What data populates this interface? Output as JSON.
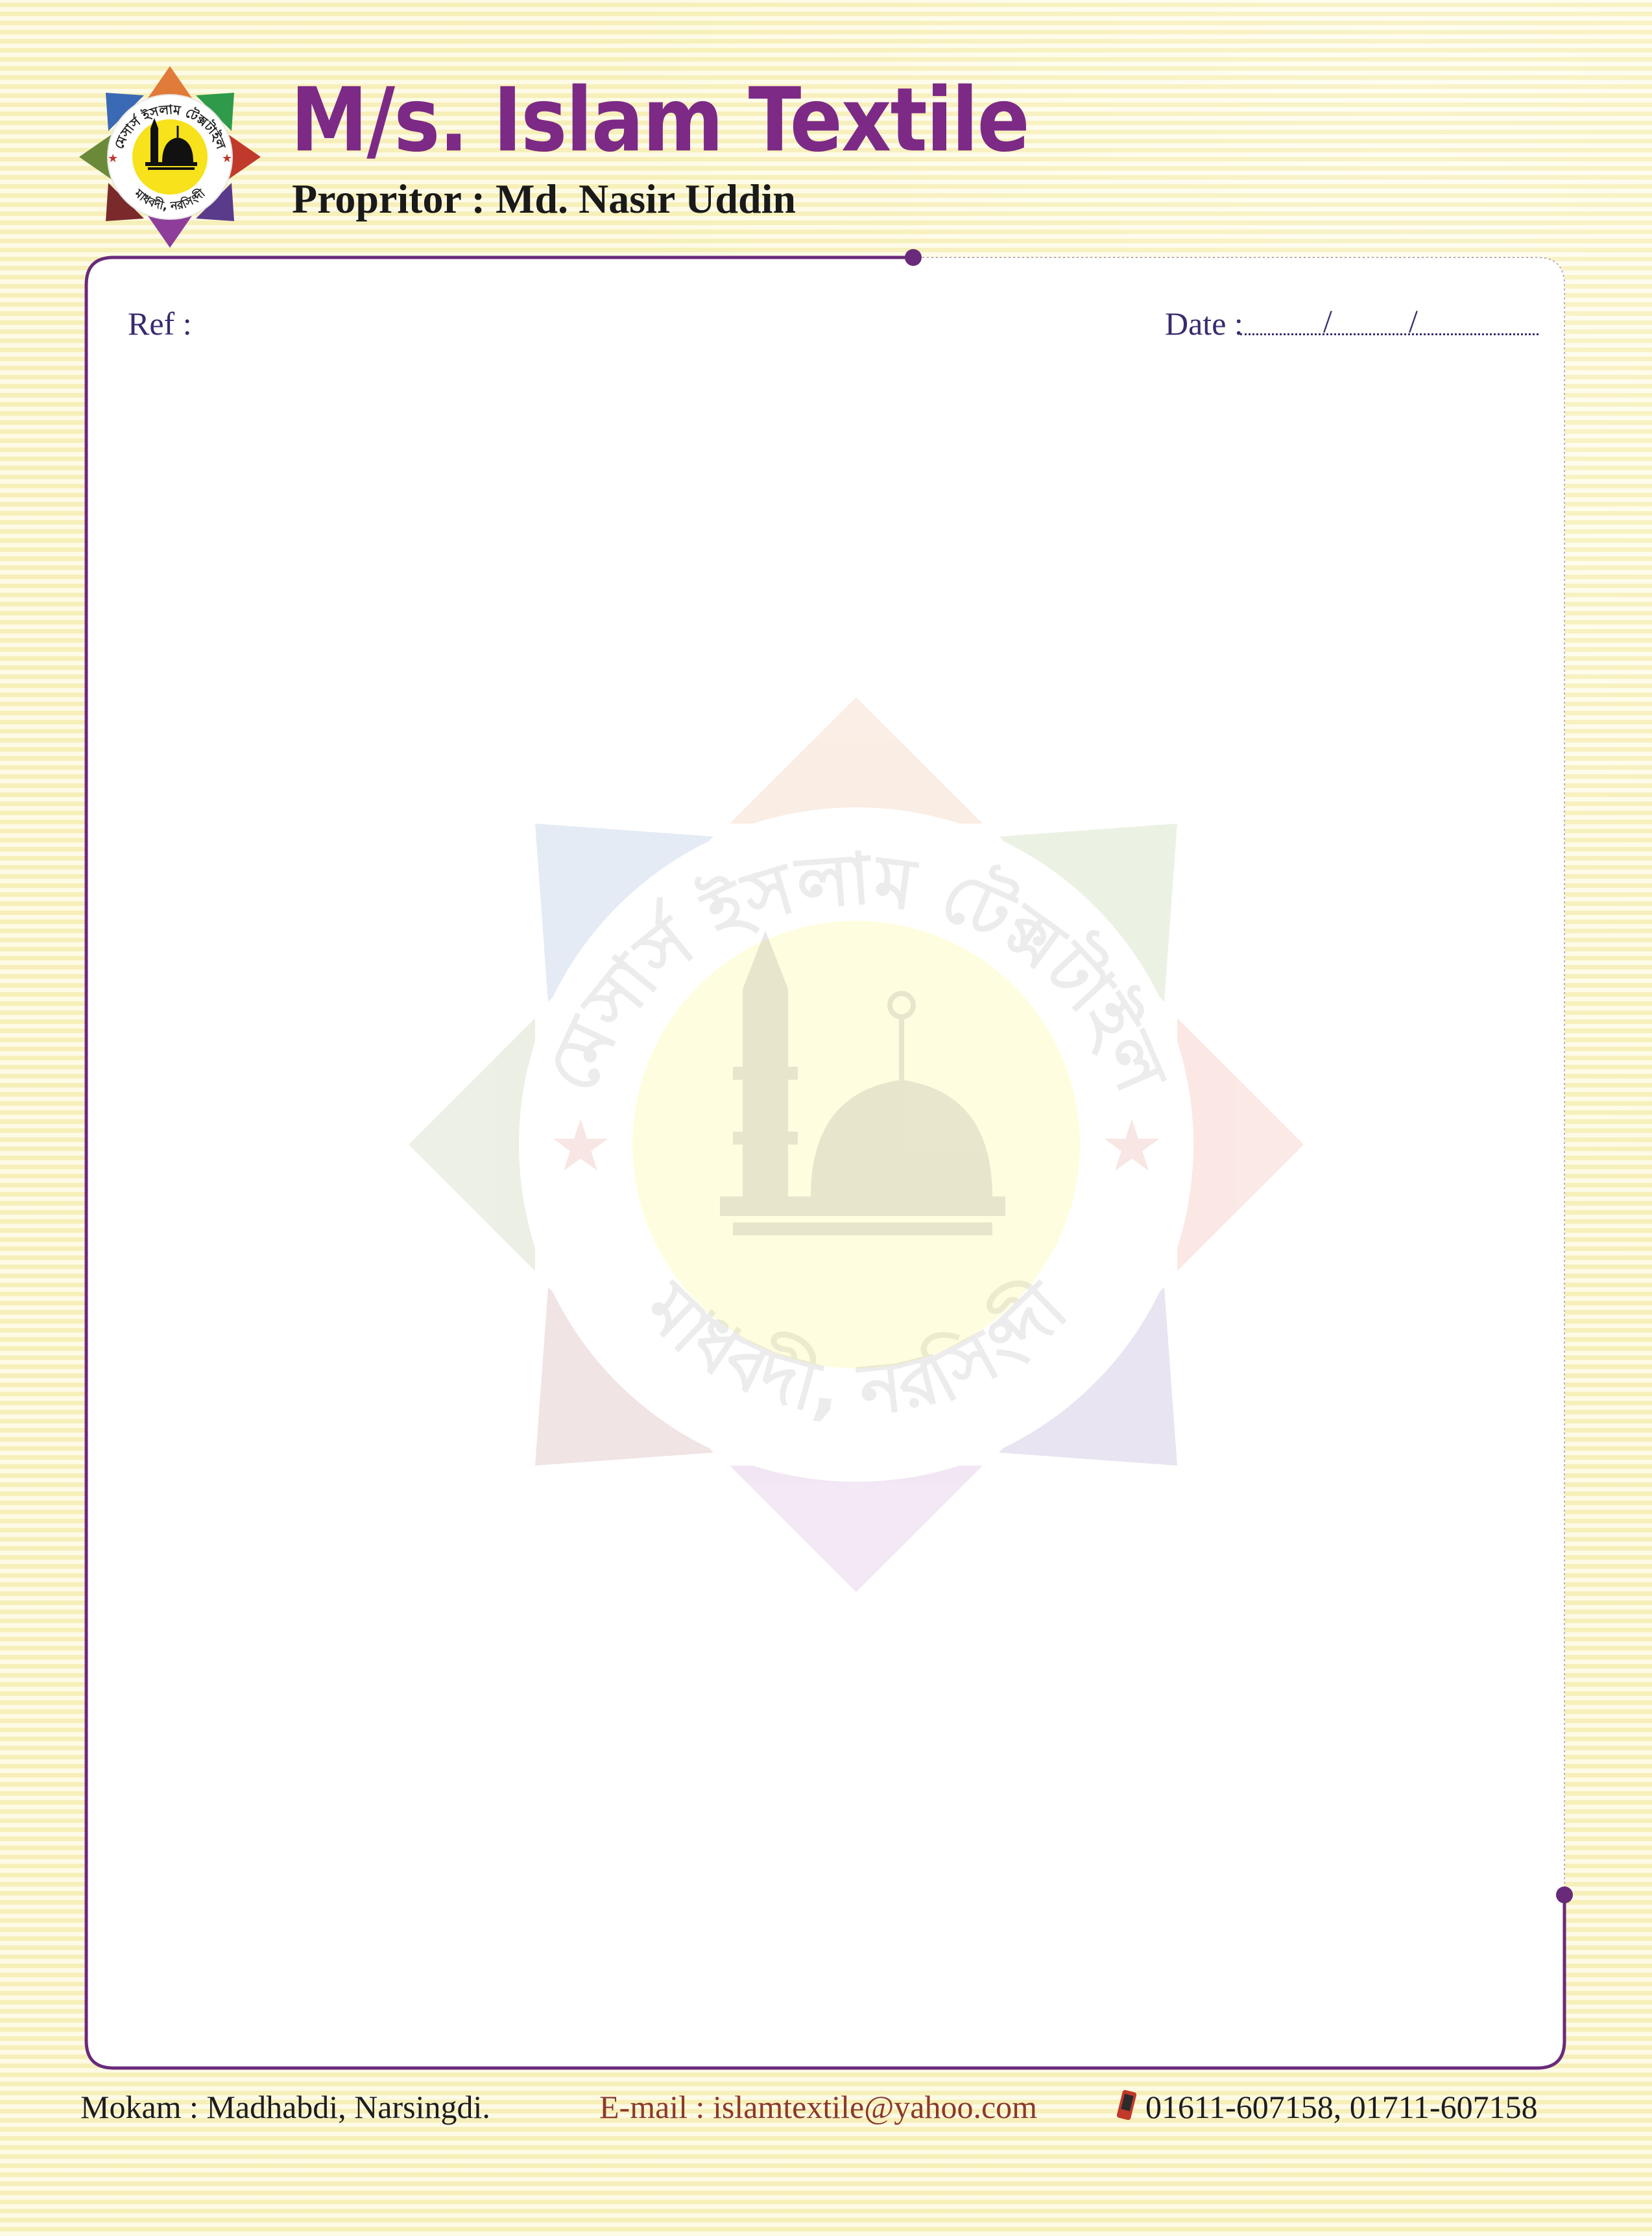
{
  "header": {
    "company_name": "M/s. Islam Textile",
    "proprietor": "Propritor : Md. Nasir Uddin",
    "logo_top_text": "মেসার্স ইসলাম টেক্সটাইল",
    "logo_bottom_text": "মাধবদী, নরসিংদী"
  },
  "form": {
    "ref_label": "Ref :",
    "date_label": "Date :",
    "date_separator": "/"
  },
  "footer": {
    "address": "Mokam : Madhabdi, Narsingdi.",
    "email": "E-mail : islamtextile@yahoo.com",
    "phones": "01611-607158, 01711-607158"
  },
  "icons": {
    "logo": "mosque-emblem-icon",
    "phone": "mobile-phone-icon"
  },
  "colors": {
    "brand_purple": "#7c2a86",
    "frame_purple": "#6a2a7a",
    "background": "#fbf5c6",
    "text_navy": "#3a2a6e",
    "email_brown": "#8b3a2a"
  }
}
